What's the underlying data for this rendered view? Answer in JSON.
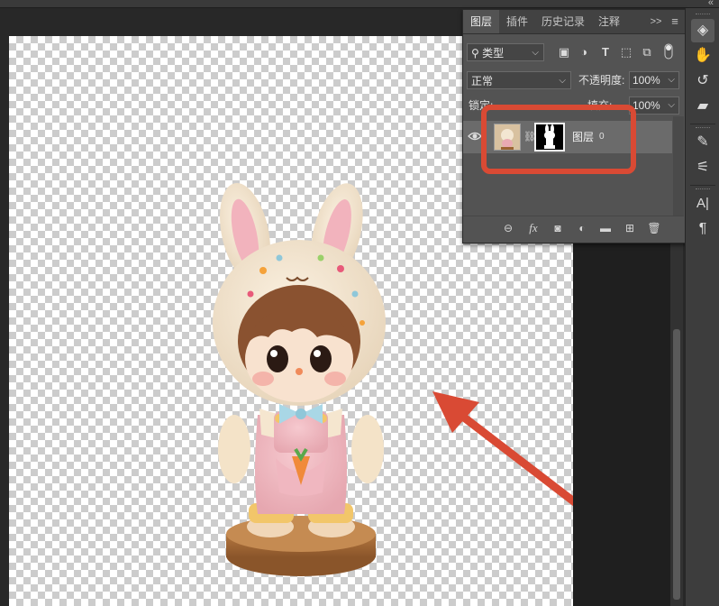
{
  "panel": {
    "tabs": [
      "图层",
      "插件",
      "历史记录",
      "注释"
    ],
    "expand_label": ">>",
    "menu_label": "≡",
    "filter": {
      "kind_label": "类型"
    },
    "blend": {
      "mode": "正常",
      "opacity_label": "不透明度:",
      "opacity_value": "100%"
    },
    "lock": {
      "label": "锁定:",
      "fill_label": "填充:",
      "fill_value": "100%"
    },
    "layer": {
      "name": "图层",
      "index": "0"
    },
    "bottom_icons": [
      "link-icon",
      "fx-icon",
      "mask-icon",
      "adjustment-icon",
      "folder-icon",
      "new-layer-icon",
      "trash-icon"
    ],
    "fx_label": "fx"
  },
  "toolstrip": {
    "type_label": "A|",
    "para_label": "¶"
  },
  "colors": {
    "annotation": "#d94a34",
    "panel_bg": "#535353",
    "selected_row": "#6b6b6b"
  }
}
